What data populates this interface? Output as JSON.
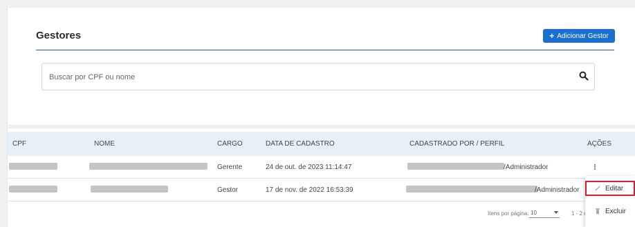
{
  "header": {
    "title": "Gestores",
    "add_button_label": "Adicionar Gestor",
    "add_button_icon": "plus-icon"
  },
  "search": {
    "placeholder": "Buscar por CPF ou nome",
    "value": "",
    "icon": "search-icon"
  },
  "table": {
    "columns": [
      "CPF",
      "NOME",
      "CARGO",
      "DATA DE CADASTRO",
      "CADASTRADO POR / PERFIL",
      "AÇÕES"
    ],
    "rows": [
      {
        "cargo": "Gerente",
        "data_cadastro": "24 de out. de 2023 11:14:47",
        "perfil": "/Administrador"
      },
      {
        "cargo": "Gestor",
        "data_cadastro": "17 de nov. de 2022 16:53:39",
        "perfil": "/Administrador"
      }
    ]
  },
  "pagination": {
    "items_per_page_label": "Itens por página:",
    "items_per_page": "10",
    "range": "1 - 2 d"
  },
  "actions_menu": {
    "items": [
      {
        "label": "Editar",
        "icon": "pencil-icon"
      },
      {
        "label": "Excluir",
        "icon": "trash-icon"
      }
    ]
  },
  "colors": {
    "primary": "#1a6fd1",
    "header_bg": "#e9f0f8",
    "highlight": "#d11f2d"
  }
}
